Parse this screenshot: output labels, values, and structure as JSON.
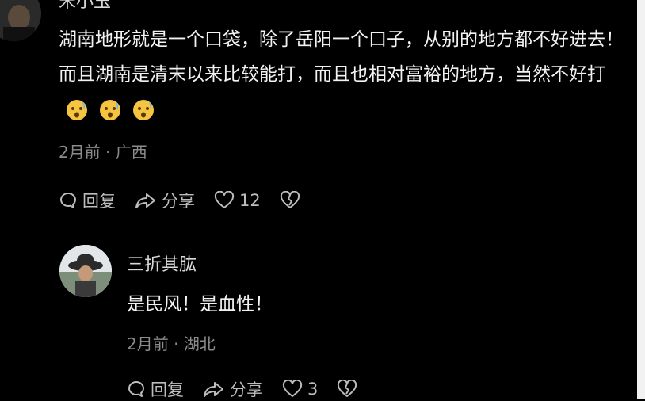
{
  "comments": [
    {
      "username": "宋小玉",
      "text": "湖南地形就是一个口袋，除了岳阳一个口子，从别的地方都不好进去！而且湖南是清末以来比较能打，而且也相对富裕的地方，当然不好打",
      "emojis": [
        "worried-face-emoji",
        "worried-face-emoji",
        "worried-face-emoji"
      ],
      "date": "2月前",
      "location": "广西",
      "reply_label": "回复",
      "share_label": "分享",
      "like_count": "12"
    }
  ],
  "replies": [
    {
      "username": "三折其肱",
      "text": "是民风！是血性！",
      "date": "2月前",
      "location": "湖北",
      "reply_label": "回复",
      "share_label": "分享",
      "like_count": "3"
    }
  ],
  "colors": {
    "background": "#000000",
    "text_primary": "#f2f2f2",
    "text_secondary": "#8c8c8c",
    "action_gray": "#bdbdbd"
  },
  "meta_separator": " · "
}
